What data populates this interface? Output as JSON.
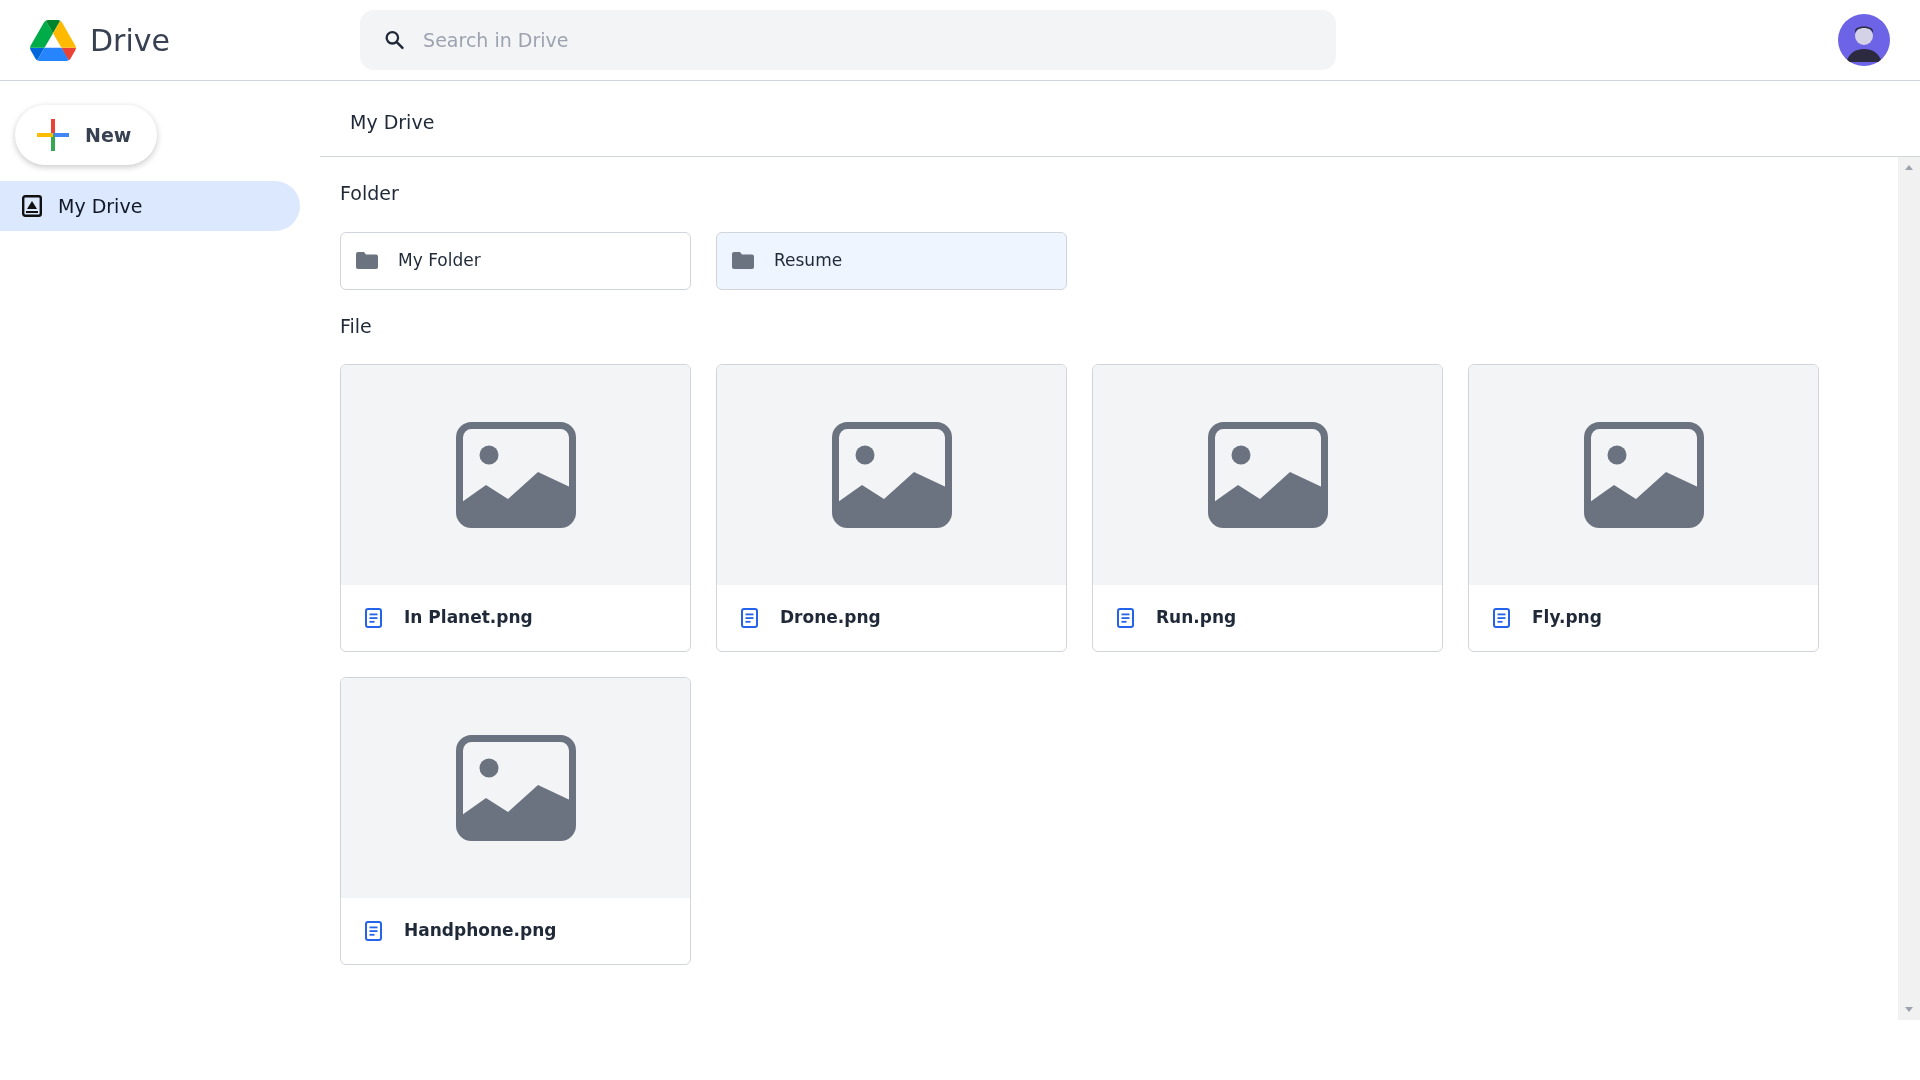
{
  "app": {
    "title": "Drive"
  },
  "search": {
    "placeholder": "Search in Drive"
  },
  "new_button": {
    "label": "New"
  },
  "sidebar": {
    "items": [
      {
        "label": "My Drive",
        "selected": true
      }
    ]
  },
  "breadcrumb": "My Drive",
  "folder_section": {
    "heading": "Folder",
    "items": [
      {
        "name": "My Folder",
        "selected": false
      },
      {
        "name": "Resume",
        "selected": true
      }
    ]
  },
  "file_section": {
    "heading": "File",
    "items": [
      {
        "name": "In Planet.png"
      },
      {
        "name": "Drone.png"
      },
      {
        "name": "Run.png"
      },
      {
        "name": "Fly.png"
      },
      {
        "name": "Handphone.png"
      }
    ]
  }
}
